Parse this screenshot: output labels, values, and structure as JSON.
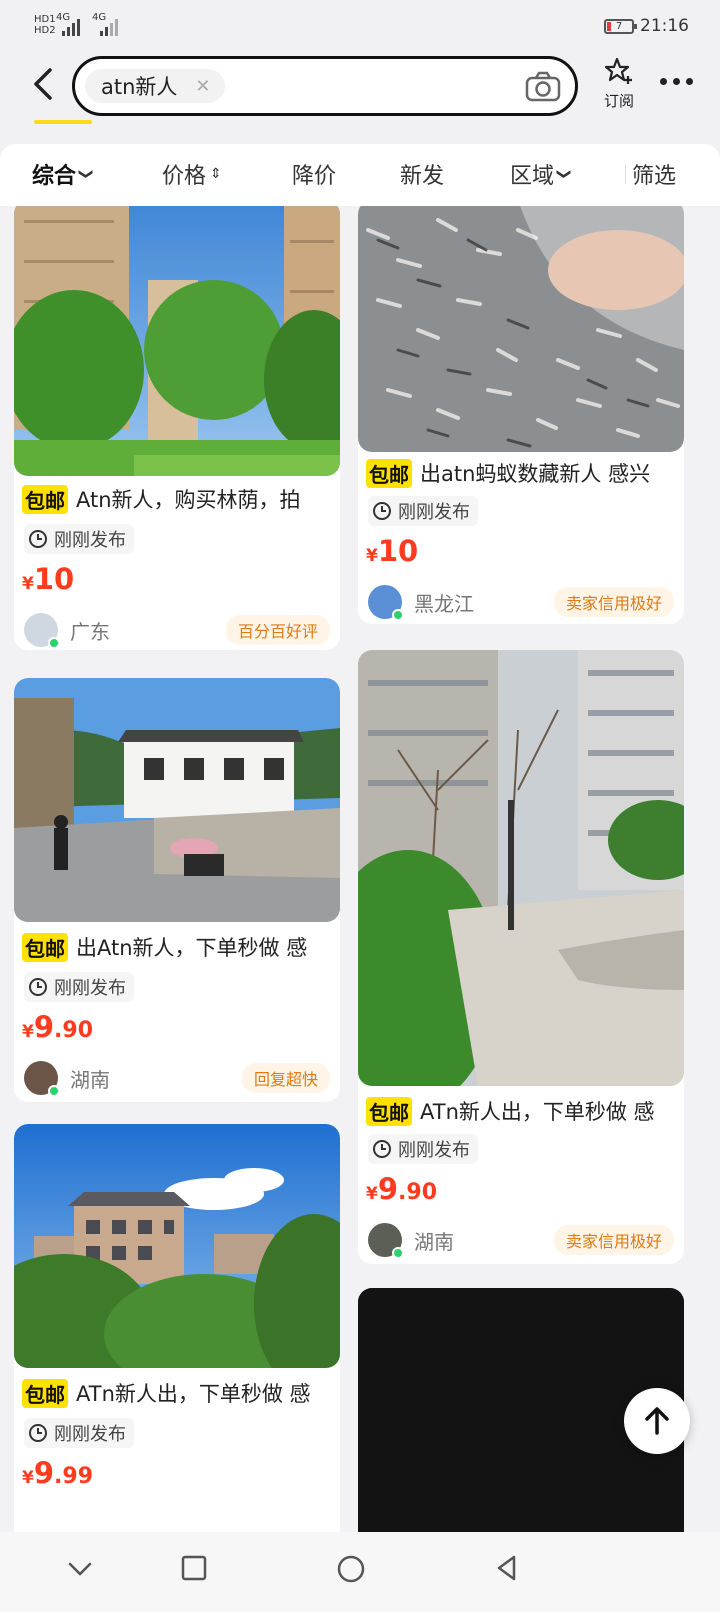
{
  "status_bar": {
    "hd1": "HD1",
    "hd2": "HD2",
    "net1": "4G",
    "net2": "4G",
    "battery": "7",
    "time": "21:16"
  },
  "search": {
    "query_chip": "atn新人",
    "clear_icon": "close-icon",
    "camera_icon": "camera-icon",
    "subscribe_label": "订阅",
    "accent_color": "#ffda1a"
  },
  "filters": [
    {
      "label": "综合",
      "arrow": "❯"
    },
    {
      "label": "价格",
      "arrow": "⇕"
    },
    {
      "label": "降价",
      "arrow": ""
    },
    {
      "label": "新发",
      "arrow": ""
    },
    {
      "label": "区域",
      "arrow": "❯"
    },
    {
      "label": "筛选",
      "arrow": ""
    }
  ],
  "items": [
    {
      "tag": "包邮",
      "title": "Atn新人，购买林荫，拍",
      "time": "刚刚发布",
      "price_int": "10",
      "price_dec": "",
      "region": "广东",
      "badge": "百分百好评"
    },
    {
      "tag": "包邮",
      "title": "出atn蚂蚁数藏新人 感兴",
      "time": "刚刚发布",
      "price_int": "10",
      "price_dec": "",
      "region": "黑龙江",
      "badge": "卖家信用极好"
    },
    {
      "tag": "包邮",
      "title": "出Atn新人，下单秒做 感",
      "time": "刚刚发布",
      "price_int": "9",
      "price_dec": ".90",
      "region": "湖南",
      "badge": "回复超快"
    },
    {
      "tag": "包邮",
      "title": "ATn新人出，下单秒做 感",
      "time": "刚刚发布",
      "price_int": "9",
      "price_dec": ".90",
      "region": "湖南",
      "badge": "卖家信用极好"
    },
    {
      "tag": "包邮",
      "title": "ATn新人出，下单秒做 感",
      "time": "刚刚发布",
      "price_int": "9",
      "price_dec": ".99",
      "region": "",
      "badge": ""
    }
  ],
  "currency": "¥",
  "price_color": "#ff3b1f"
}
